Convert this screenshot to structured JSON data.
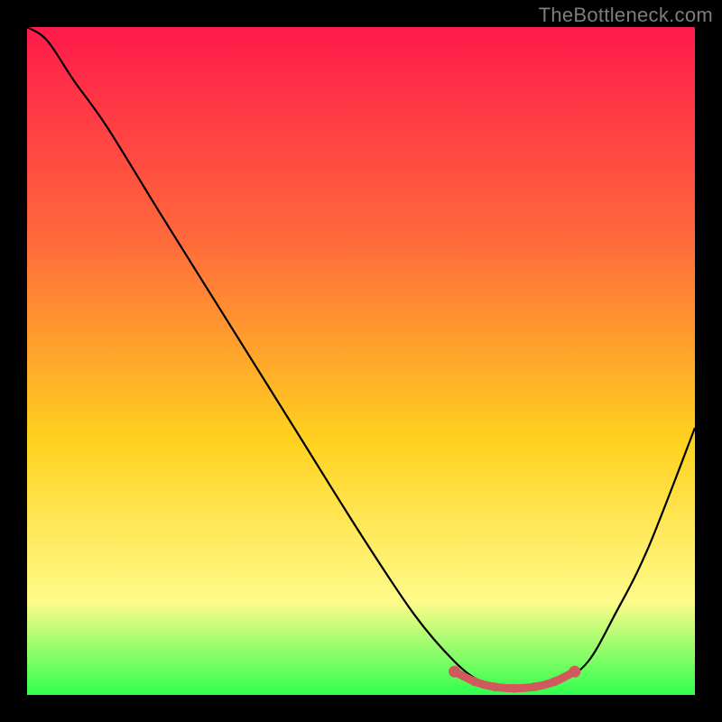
{
  "watermark": "TheBottleneck.com",
  "colors": {
    "background_black": "#000000",
    "gradient_top": "#ff1a4b",
    "gradient_mid1": "#ff6a3b",
    "gradient_mid2": "#ffd21f",
    "gradient_bottom1": "#fffb8a",
    "gradient_bottom2": "#2fff4e",
    "curve_stroke": "#000000",
    "dots": "#d1595d"
  },
  "chart_data": {
    "type": "line",
    "title": "",
    "xlabel": "",
    "ylabel": "",
    "x": [
      0.0,
      0.03,
      0.07,
      0.12,
      0.2,
      0.3,
      0.4,
      0.5,
      0.58,
      0.64,
      0.68,
      0.72,
      0.76,
      0.8,
      0.84,
      0.88,
      0.93,
      1.0
    ],
    "values": [
      1.0,
      0.98,
      0.92,
      0.85,
      0.72,
      0.56,
      0.4,
      0.24,
      0.12,
      0.05,
      0.02,
      0.01,
      0.01,
      0.02,
      0.05,
      0.12,
      0.22,
      0.4
    ],
    "xlim": [
      0,
      1
    ],
    "ylim": [
      0,
      1
    ],
    "marker_points": {
      "x": [
        0.64,
        0.67,
        0.7,
        0.73,
        0.76,
        0.79,
        0.82
      ],
      "y": [
        0.035,
        0.02,
        0.012,
        0.01,
        0.012,
        0.02,
        0.035
      ]
    }
  }
}
